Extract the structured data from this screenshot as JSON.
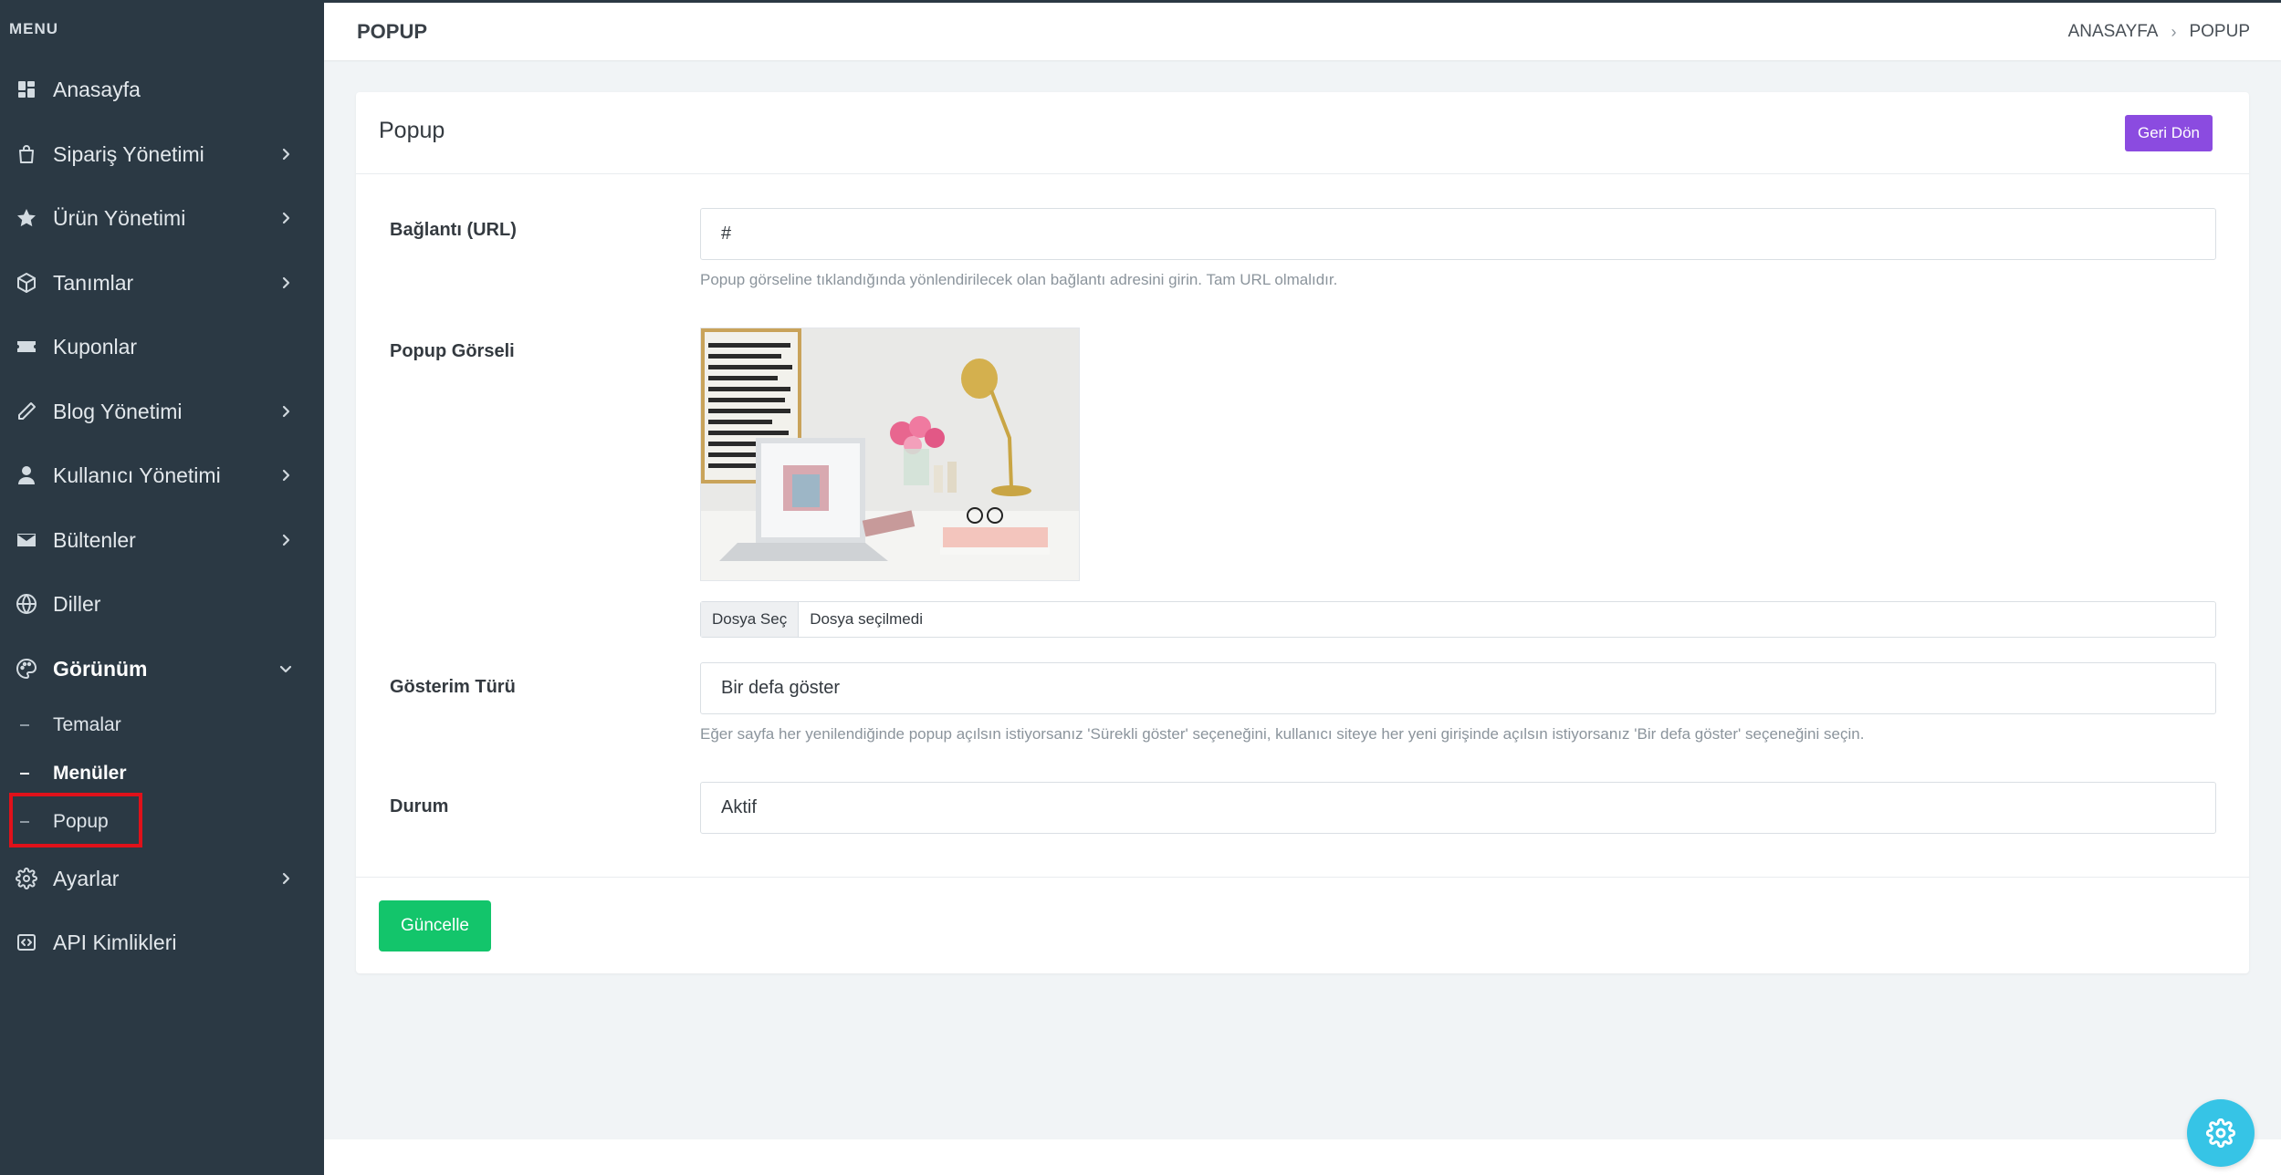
{
  "sidebar": {
    "menu_title": "MENU",
    "items": [
      {
        "label": "Anasayfa",
        "icon": "dashboard-icon"
      },
      {
        "label": "Sipariş Yönetimi",
        "icon": "shopping-bag-icon"
      },
      {
        "label": "Ürün Yönetimi",
        "icon": "star-icon"
      },
      {
        "label": "Tanımlar",
        "icon": "box-icon"
      },
      {
        "label": "Kuponlar",
        "icon": "ticket-icon"
      },
      {
        "label": "Blog Yönetimi",
        "icon": "pencil-icon"
      },
      {
        "label": "Kullanıcı Yönetimi",
        "icon": "user-icon"
      },
      {
        "label": "Bültenler",
        "icon": "envelope-icon"
      },
      {
        "label": "Diller",
        "icon": "globe-icon"
      },
      {
        "label": "Görünüm",
        "icon": "palette-icon"
      },
      {
        "label": "Ayarlar",
        "icon": "gear-icon"
      },
      {
        "label": "API Kimlikleri",
        "icon": "code-icon"
      }
    ],
    "subitems": [
      {
        "label": "Temalar"
      },
      {
        "label": "Menüler"
      },
      {
        "label": "Popup"
      }
    ]
  },
  "header": {
    "title": "POPUP",
    "breadcrumb": [
      "ANASAYFA",
      "POPUP"
    ]
  },
  "card": {
    "title": "Popup",
    "back_button": "Geri Dön",
    "fields": {
      "url_label": "Bağlantı (URL)",
      "url_value": "#",
      "url_help": "Popup görseline tıklandığında yönlendirilecek olan bağlantı adresini girin. Tam URL olmalıdır.",
      "image_label": "Popup Görseli",
      "file_button": "Dosya Seç",
      "file_name": "Dosya seçilmedi",
      "display_label": "Gösterim Türü",
      "display_value": "Bir defa göster",
      "display_help": "Eğer sayfa her yenilendiğinde popup açılsın istiyorsanız 'Sürekli göster' seçeneğini, kullanıcı siteye her yeni girişinde açılsın istiyorsanız 'Bir defa göster' seçeneğini seçin.",
      "status_label": "Durum",
      "status_value": "Aktif"
    },
    "submit_button": "Güncelle"
  },
  "colors": {
    "sidebar_bg": "#2b3944",
    "back_button": "#8b4be0",
    "submit_button": "#13c56b",
    "fab": "#36c4e6",
    "highlight": "#e0111a"
  }
}
